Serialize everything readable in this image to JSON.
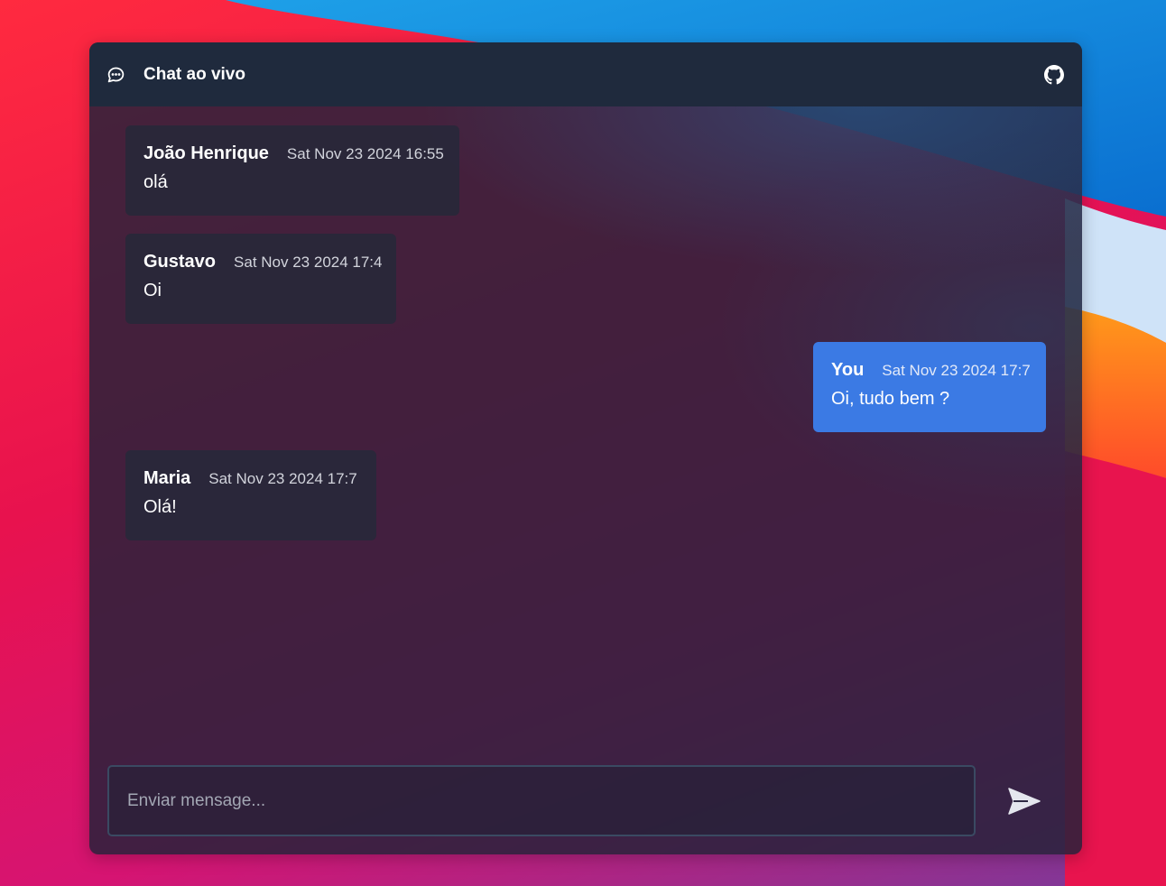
{
  "header": {
    "title": "Chat ao vivo",
    "chat_icon": "chat-bubble-icon",
    "github_icon": "github-icon"
  },
  "messages": [
    {
      "author": "João Henrique",
      "time": "Sat Nov 23 2024 16:55",
      "text": "olá",
      "mine": false
    },
    {
      "author": "Gustavo",
      "time": "Sat Nov 23 2024 17:4",
      "text": "Oi",
      "mine": false
    },
    {
      "author": "You",
      "time": "Sat Nov 23 2024 17:7",
      "text": "Oi, tudo bem ?",
      "mine": true
    },
    {
      "author": "Maria",
      "time": "Sat Nov 23 2024 17:7",
      "text": "Olá!",
      "mine": false
    }
  ],
  "composer": {
    "placeholder": "Enviar mensage...",
    "value": "",
    "send_icon": "send-icon"
  },
  "colors": {
    "header_bg": "#1f2a3d",
    "own_message_bg": "#3b7ae4",
    "other_message_bg": "#28283a"
  }
}
